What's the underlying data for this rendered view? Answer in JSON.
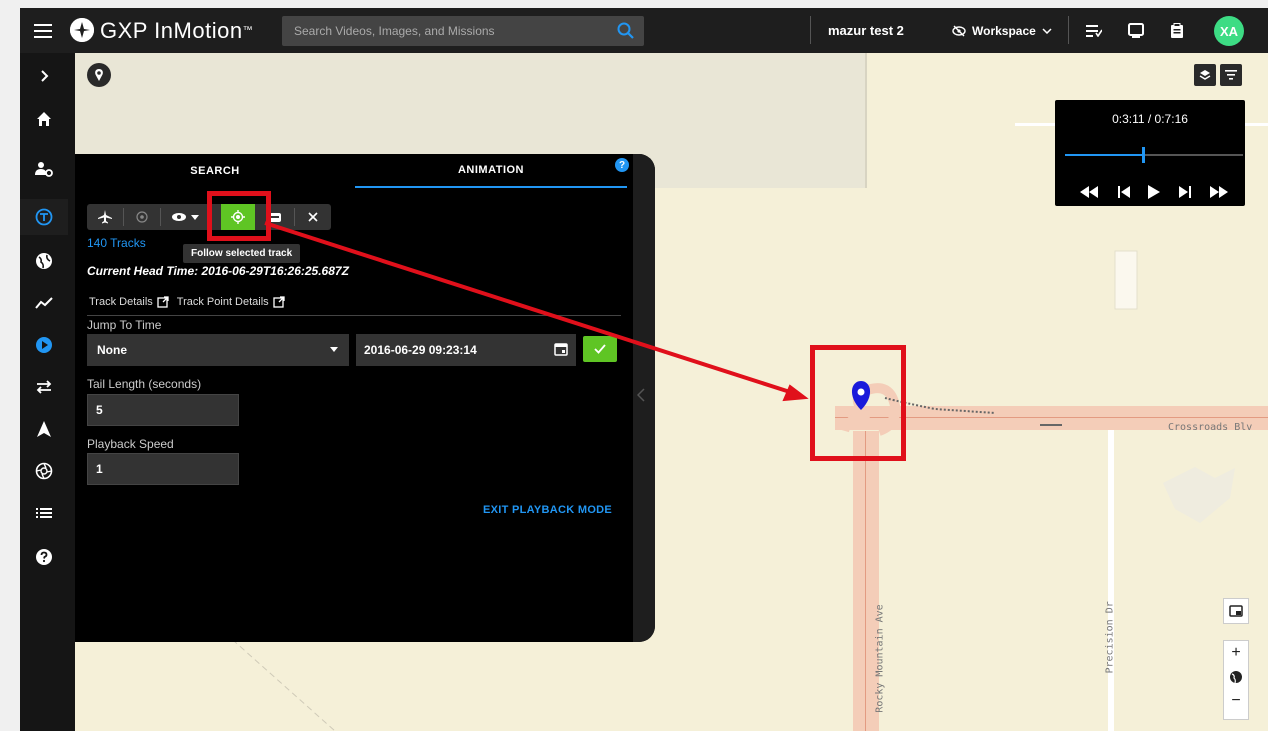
{
  "app": {
    "title": "GXP InMotion",
    "trademark": "™"
  },
  "search": {
    "placeholder": "Search Videos, Images, and Missions"
  },
  "header": {
    "mission": "mazur test 2",
    "workspace_label": "Workspace",
    "avatar_initials": "XA"
  },
  "panel": {
    "tabs": [
      "SEARCH",
      "ANIMATION"
    ],
    "active_tab": "ANIMATION",
    "tooltip": "Follow selected track",
    "track_count": "140 Tracks",
    "head_time": "Current Head Time: 2016-06-29T16:26:25.687Z",
    "links": [
      "Track Details",
      "Track Point Details"
    ],
    "jump_to_time": {
      "label": "Jump To Time",
      "selected": "None",
      "datetime": "2016-06-29 09:23:14"
    },
    "tail_length": {
      "label": "Tail Length (seconds)",
      "value": "5"
    },
    "playback_speed": {
      "label": "Playback Speed",
      "value": "1"
    },
    "exit_label": "EXIT PLAYBACK MODE"
  },
  "playback": {
    "time": "0:3:11 / 0:7:16",
    "progress": 0.438
  },
  "map": {
    "road_labels": [
      "Crossroads Blv",
      "Rocky Mountain Ave",
      "Precision Dr"
    ]
  },
  "colors": {
    "accent_blue": "#2196f3",
    "active_green": "#5fc524",
    "annotation_red": "#e0101b",
    "marker_blue": "#1a1adb",
    "map_bg": "#f5f0d8",
    "road": "#f4cdb8"
  },
  "icons": {
    "rail": [
      "chevron-right-icon",
      "home-icon",
      "user-settings-icon",
      "track-icon",
      "globe-icon",
      "trend-icon",
      "play-circle-icon",
      "swap-icon",
      "navigation-arrow-icon",
      "aperture-icon",
      "list-icon",
      "help-icon"
    ]
  }
}
